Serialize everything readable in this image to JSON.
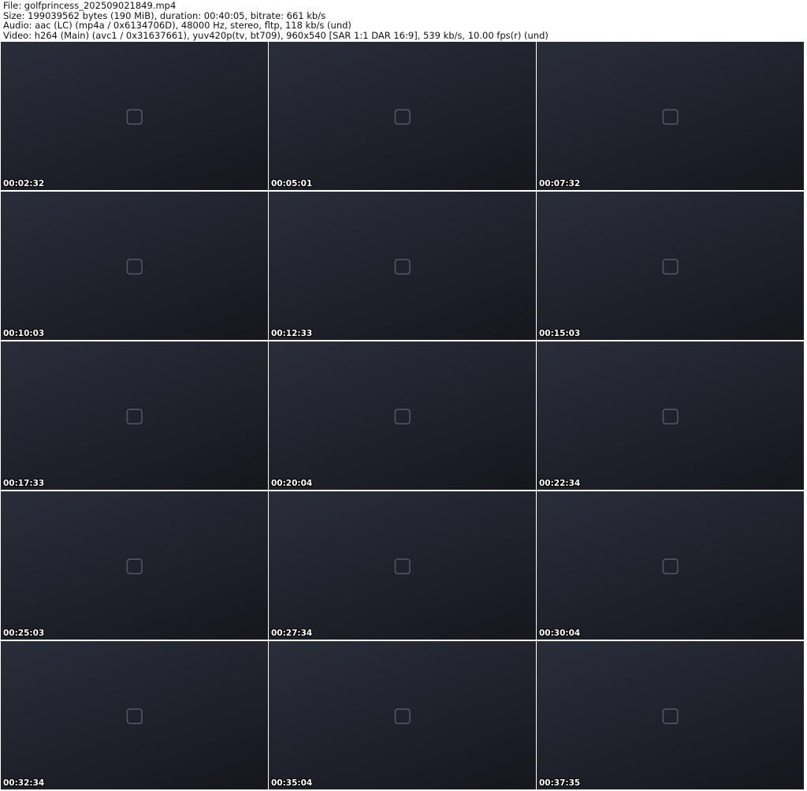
{
  "header": {
    "file": "File: golfprincess_202509021849.mp4",
    "size": "Size: 199039562 bytes (190 MiB), duration: 00:40:05, bitrate: 661 kb/s",
    "audio": "Audio: aac (LC) (mp4a / 0x6134706D), 48000 Hz, stereo, fltp, 118 kb/s (und)",
    "video": "Video: h264 (Main) (avc1 / 0x31637661), yuv420p(tv, bt709), 960x540 [SAR 1:1 DAR 16:9], 539 kb/s, 10.00 fps(r) (und)"
  },
  "thumbnails": [
    {
      "timestamp": "00:02:32"
    },
    {
      "timestamp": "00:05:01"
    },
    {
      "timestamp": "00:07:32"
    },
    {
      "timestamp": "00:10:03"
    },
    {
      "timestamp": "00:12:33"
    },
    {
      "timestamp": "00:15:03"
    },
    {
      "timestamp": "00:17:33"
    },
    {
      "timestamp": "00:20:04"
    },
    {
      "timestamp": "00:22:34"
    },
    {
      "timestamp": "00:25:03"
    },
    {
      "timestamp": "00:27:34"
    },
    {
      "timestamp": "00:30:04"
    },
    {
      "timestamp": "00:32:34"
    },
    {
      "timestamp": "00:35:04"
    },
    {
      "timestamp": "00:37:35"
    }
  ]
}
